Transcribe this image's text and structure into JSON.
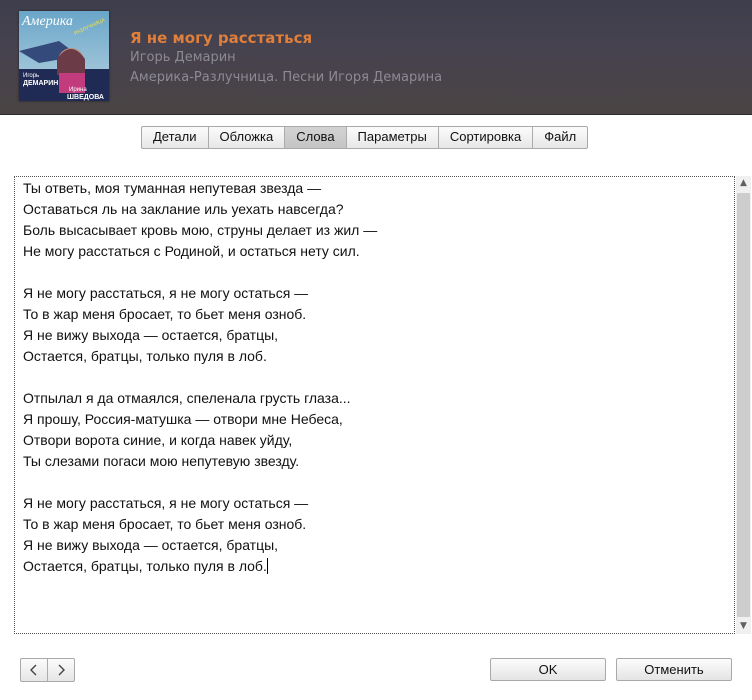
{
  "header": {
    "cover": {
      "title_text": "Америка",
      "subtitle_text": "РАЗЛУЧНИЦА",
      "artist1_first": "Игорь",
      "artist1_last": "ДЕМАРИН",
      "artist2_first": "Ирина",
      "artist2_last": "ШВЕДОВА"
    },
    "title": "Я не могу расстаться",
    "artist": "Игорь Демарин",
    "album": "Америка-Разлучница. Песни Игоря Демарина"
  },
  "tabs": [
    {
      "label": "Детали",
      "active": false
    },
    {
      "label": "Обложка",
      "active": false
    },
    {
      "label": "Слова",
      "active": true
    },
    {
      "label": "Параметры",
      "active": false
    },
    {
      "label": "Сортировка",
      "active": false
    },
    {
      "label": "Файл",
      "active": false
    }
  ],
  "lyrics": [
    "Ты ответь, моя туманная непутевая звезда —",
    "Оставаться ль на заклание иль уехать навсегда?",
    "Боль высасывает кровь мою, струны делает из жил —",
    "Не могу расстаться с Родиной, и остаться нету сил.",
    "",
    "Я не могу расстаться, я не могу остаться —",
    "То в жар меня бросает, то бьет меня озноб.",
    "Я не вижу выхода — остается, братцы,",
    "Остается, братцы, только пуля в лоб.",
    "",
    "Отпылал я да отмаялся, спеленала грусть глаза...",
    "Я прошу, Россия-матушка — отвори мне Небеса,",
    "Отвори ворота синие, и когда навек уйду,",
    "Ты слезами погаси мою непутевую звезду.",
    "",
    "Я не могу расстаться, я не могу остаться —",
    "То в жар меня бросает, то бьет меня озноб.",
    "Я не вижу выхода — остается, братцы,",
    "Остается, братцы, только пуля в лоб."
  ],
  "buttons": {
    "ok": "OK",
    "cancel": "Отменить",
    "prev_icon": "chevron-left-icon",
    "next_icon": "chevron-right-icon"
  },
  "colors": {
    "title": "#e07f3a",
    "subtitle": "#8c8a93",
    "header_bg": "#46424f"
  }
}
